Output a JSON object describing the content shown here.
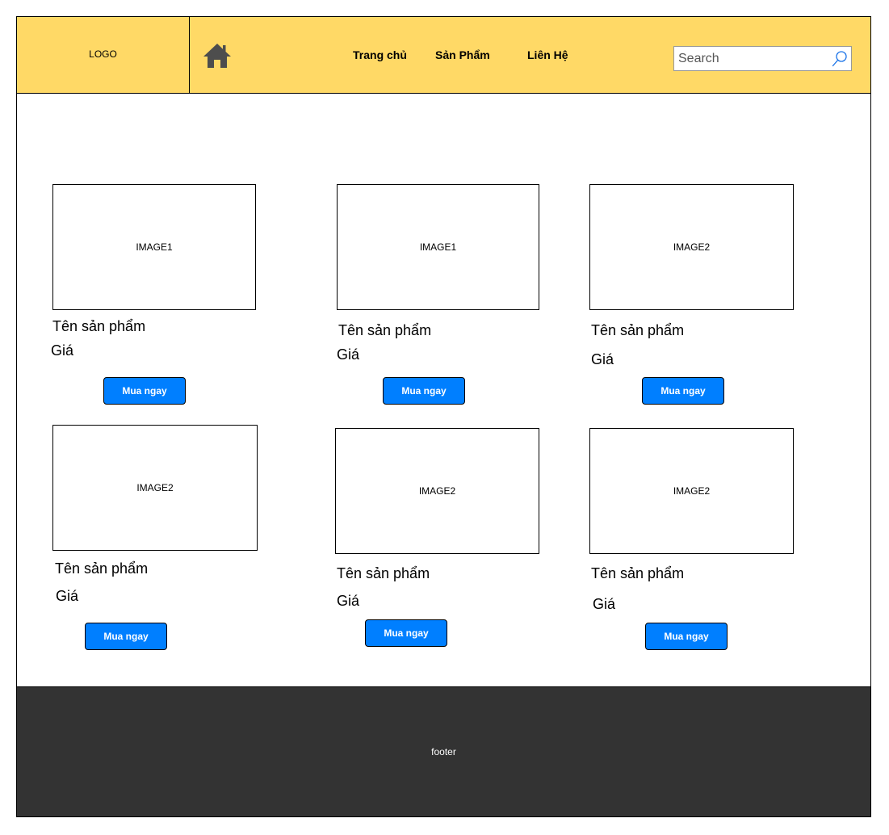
{
  "header": {
    "logo": "LOGO",
    "nav": [
      "Trang chủ",
      "Sản Phẩm",
      "Liên Hệ"
    ],
    "search_placeholder": "Search",
    "home_icon": "home-icon",
    "search_icon": "magnifier-icon"
  },
  "products": [
    {
      "image": "IMAGE1",
      "name": "Tên sản phẩm",
      "price": "Giá",
      "button": "Mua ngay"
    },
    {
      "image": "IMAGE1",
      "name": "Tên sản phẩm",
      "price": "Giá",
      "button": "Mua ngay"
    },
    {
      "image": "IMAGE2",
      "name": "Tên sản phẩm",
      "price": "Giá",
      "button": "Mua ngay"
    },
    {
      "image": "IMAGE2",
      "name": "Tên sản phẩm",
      "price": "Giá",
      "button": "Mua ngay"
    },
    {
      "image": "IMAGE2",
      "name": "Tên sản phẩm",
      "price": "Giá",
      "button": "Mua ngay"
    },
    {
      "image": "IMAGE2",
      "name": "Tên sản phẩm",
      "price": "Giá",
      "button": "Mua ngay"
    }
  ],
  "footer": {
    "text": "footer"
  },
  "colors": {
    "header_bg": "#FFD966",
    "button_bg": "#007FFF",
    "footer_bg": "#333333"
  }
}
